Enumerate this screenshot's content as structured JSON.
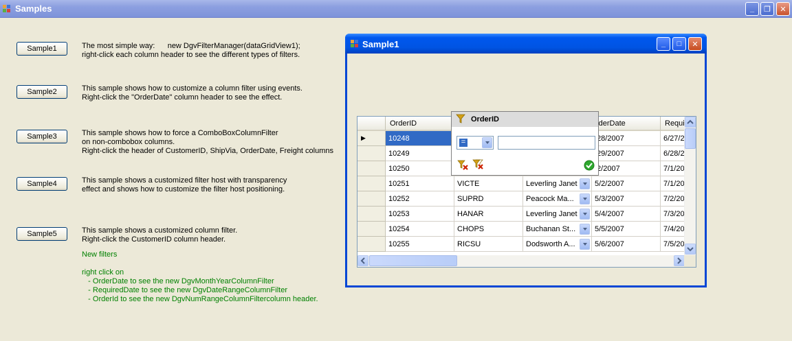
{
  "window": {
    "title": "Samples",
    "controls": {
      "minimize": "_",
      "restore": "❐",
      "close": "✕"
    }
  },
  "samples": [
    {
      "label": "Sample1",
      "description": "The most simple way:      new DgvFilterManager(dataGridView1);\nright-click each column header to see the different types of filters."
    },
    {
      "label": "Sample2",
      "description": "This sample shows how to customize a column filter using events.\nRight-click the \"OrderDate\" column header to see the effect."
    },
    {
      "label": "Sample3",
      "description": "This sample shows how to force a ComboBoxColumnFilter\non non-combobox columns.\nRight-click the header of CustomerID, ShipVia, OrderDate, Freight columns"
    },
    {
      "label": "Sample4",
      "description": "This sample shows a customized filter host with transparency\neffect and shows how to customize the filter host positioning."
    },
    {
      "label": "Sample5",
      "description": "This sample shows a customized column filter.\nRight-click the CustomerID column header."
    }
  ],
  "new_filters": {
    "title": "New filters",
    "text": "right click on\n   - OrderDate to see the new DgvMonthYearColumnFilter\n   - RequiredDate to see the new DgvDateRangeColumnFilter\n   - OrderId to see the new DgvNumRangeColumnFiltercolumn header."
  },
  "inner_window": {
    "title": "Sample1",
    "controls": {
      "minimize": "_",
      "maximize": "□",
      "close": "✕"
    }
  },
  "grid": {
    "columns": [
      "OrderID",
      "",
      "",
      "rderDate",
      "Requi"
    ],
    "rows": [
      [
        "10248",
        "",
        "",
        "/28/2007",
        "6/27/2"
      ],
      [
        "10249",
        "",
        "",
        "/29/2007",
        "6/28/2"
      ],
      [
        "10250",
        "",
        "",
        "/2/2007",
        "7/1/20"
      ],
      [
        "10251",
        "VICTE",
        "Leverling Janet",
        "5/2/2007",
        "7/1/20"
      ],
      [
        "10252",
        "SUPRD",
        "Peacock Ma...",
        "5/3/2007",
        "7/2/20"
      ],
      [
        "10253",
        "HANAR",
        "Leverling Janet",
        "5/4/2007",
        "7/3/20"
      ],
      [
        "10254",
        "CHOPS",
        "Buchanan St...",
        "5/5/2007",
        "7/4/20"
      ],
      [
        "10255",
        "RICSU",
        "Dodsworth A...",
        "5/6/2007",
        "7/5/20"
      ]
    ],
    "selected_row": 0,
    "current_row_marker": "▶"
  },
  "filter_popup": {
    "title": "OrderID",
    "operator": "=",
    "value": "",
    "colors": {
      "funnel": "#d4a017",
      "ok": "#2ea82e",
      "remove": "#cc2200"
    }
  }
}
